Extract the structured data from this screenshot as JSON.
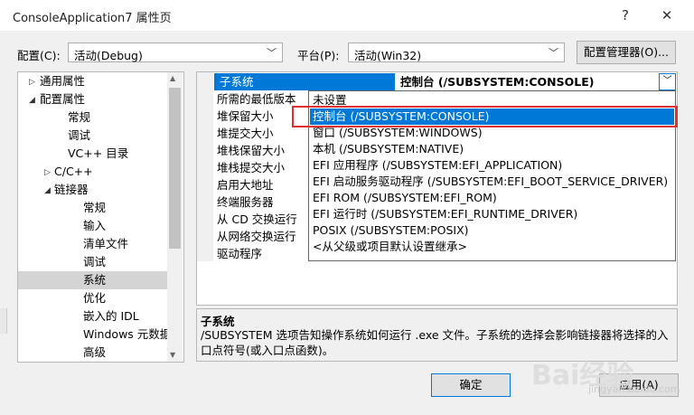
{
  "window": {
    "title": "ConsoleApplication7 属性页",
    "help_glyph": "?",
    "close_glyph": "✕"
  },
  "toolbar": {
    "config_label": "配置(C):",
    "config_value": "活动(Debug)",
    "platform_label": "平台(P):",
    "platform_value": "活动(Win32)",
    "config_manager_label": "配置管理器(O)..."
  },
  "tree": {
    "items": [
      {
        "label": "通用属性",
        "arrow": "▷"
      },
      {
        "label": "配置属性",
        "arrow": "◢"
      },
      {
        "label": "常规"
      },
      {
        "label": "调试"
      },
      {
        "label": "VC++ 目录"
      },
      {
        "label": "C/C++",
        "arrow": "▷"
      },
      {
        "label": "链接器",
        "arrow": "◢"
      },
      {
        "label": "常规"
      },
      {
        "label": "输入"
      },
      {
        "label": "清单文件"
      },
      {
        "label": "调试"
      },
      {
        "label": "系统"
      },
      {
        "label": "优化"
      },
      {
        "label": "嵌入的 IDL"
      },
      {
        "label": "Windows 元数据"
      },
      {
        "label": "高级"
      }
    ],
    "selected_label": "系统"
  },
  "properties": {
    "selected_name": "子系统",
    "selected_value": "控制台 (/SUBSYSTEM:CONSOLE)",
    "rows": [
      "所需的最低版本",
      "堆保留大小",
      "堆提交大小",
      "堆栈保留大小",
      "堆栈提交大小",
      "启用大地址",
      "终端服务器",
      "从 CD 交换运行",
      "从网络交换运行",
      "驱动程序"
    ]
  },
  "dropdown": {
    "options": [
      "未设置",
      "控制台 (/SUBSYSTEM:CONSOLE)",
      "窗口 (/SUBSYSTEM:WINDOWS)",
      "本机 (/SUBSYSTEM:NATIVE)",
      "EFI 应用程序 (/SUBSYSTEM:EFI_APPLICATION)",
      "EFI 启动服务驱动程序 (/SUBSYSTEM:EFI_BOOT_SERVICE_DRIVER)",
      "EFI ROM (/SUBSYSTEM:EFI_ROM)",
      "EFI 运行时 (/SUBSYSTEM:EFI_RUNTIME_DRIVER)",
      "POSIX (/SUBSYSTEM:POSIX)",
      "<从父级或项目默认设置继承>"
    ],
    "highlighted_index": 1
  },
  "description": {
    "title": "子系统",
    "body": "/SUBSYSTEM 选项告知操作系统如何运行 .exe 文件。子系统的选择会影响链接器将选择的入口点符号(或入口点函数)。"
  },
  "buttons": {
    "ok_label": "确定",
    "apply_label": "应用(A)"
  },
  "watermark": {
    "brand": "Bai经验",
    "url": "jingyan.baidu.com"
  },
  "colors": {
    "accent": "#0078d7",
    "annotation_red": "#e03030"
  }
}
